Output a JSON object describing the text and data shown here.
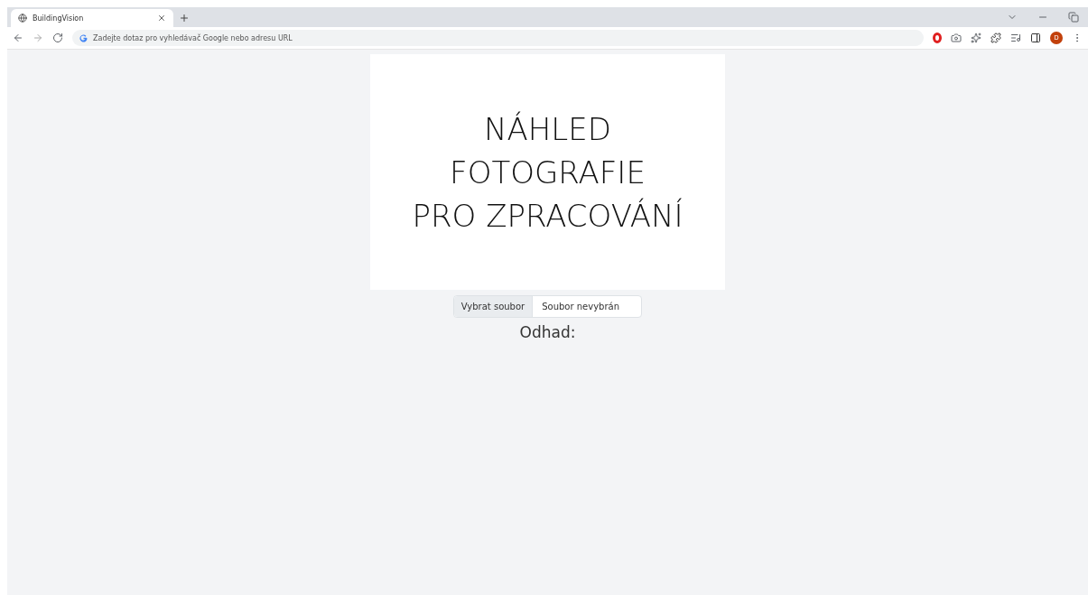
{
  "browser": {
    "tabs": [
      {
        "title": "BuildingVision",
        "selected": true
      }
    ],
    "address_placeholder": "Zadejte dotaz pro vyhledávač Google nebo adresu URL",
    "profile_initial": "D"
  },
  "preview": {
    "lines": [
      "NÁHLED",
      "FOTOGRAFIE",
      "PRO ZPRACOVÁNÍ"
    ]
  },
  "file_input": {
    "button": "Vybrat soubor",
    "status": "Soubor nevybrán"
  },
  "result_label": "Odhad:"
}
